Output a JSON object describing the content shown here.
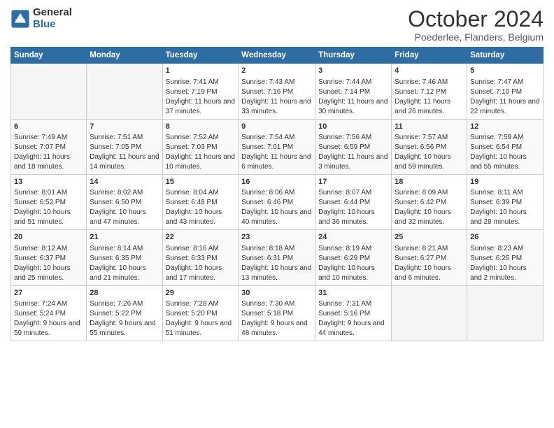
{
  "logo": {
    "general": "General",
    "blue": "Blue"
  },
  "title": "October 2024",
  "subtitle": "Poederlee, Flanders, Belgium",
  "days_of_week": [
    "Sunday",
    "Monday",
    "Tuesday",
    "Wednesday",
    "Thursday",
    "Friday",
    "Saturday"
  ],
  "weeks": [
    [
      {
        "day": "",
        "info": ""
      },
      {
        "day": "",
        "info": ""
      },
      {
        "day": "1",
        "info": "Sunrise: 7:41 AM\nSunset: 7:19 PM\nDaylight: 11 hours and 37 minutes."
      },
      {
        "day": "2",
        "info": "Sunrise: 7:43 AM\nSunset: 7:16 PM\nDaylight: 11 hours and 33 minutes."
      },
      {
        "day": "3",
        "info": "Sunrise: 7:44 AM\nSunset: 7:14 PM\nDaylight: 11 hours and 30 minutes."
      },
      {
        "day": "4",
        "info": "Sunrise: 7:46 AM\nSunset: 7:12 PM\nDaylight: 11 hours and 26 minutes."
      },
      {
        "day": "5",
        "info": "Sunrise: 7:47 AM\nSunset: 7:10 PM\nDaylight: 11 hours and 22 minutes."
      }
    ],
    [
      {
        "day": "6",
        "info": "Sunrise: 7:49 AM\nSunset: 7:07 PM\nDaylight: 11 hours and 18 minutes."
      },
      {
        "day": "7",
        "info": "Sunrise: 7:51 AM\nSunset: 7:05 PM\nDaylight: 11 hours and 14 minutes."
      },
      {
        "day": "8",
        "info": "Sunrise: 7:52 AM\nSunset: 7:03 PM\nDaylight: 11 hours and 10 minutes."
      },
      {
        "day": "9",
        "info": "Sunrise: 7:54 AM\nSunset: 7:01 PM\nDaylight: 11 hours and 6 minutes."
      },
      {
        "day": "10",
        "info": "Sunrise: 7:56 AM\nSunset: 6:59 PM\nDaylight: 11 hours and 3 minutes."
      },
      {
        "day": "11",
        "info": "Sunrise: 7:57 AM\nSunset: 6:56 PM\nDaylight: 10 hours and 59 minutes."
      },
      {
        "day": "12",
        "info": "Sunrise: 7:59 AM\nSunset: 6:54 PM\nDaylight: 10 hours and 55 minutes."
      }
    ],
    [
      {
        "day": "13",
        "info": "Sunrise: 8:01 AM\nSunset: 6:52 PM\nDaylight: 10 hours and 51 minutes."
      },
      {
        "day": "14",
        "info": "Sunrise: 8:02 AM\nSunset: 6:50 PM\nDaylight: 10 hours and 47 minutes."
      },
      {
        "day": "15",
        "info": "Sunrise: 8:04 AM\nSunset: 6:48 PM\nDaylight: 10 hours and 43 minutes."
      },
      {
        "day": "16",
        "info": "Sunrise: 8:06 AM\nSunset: 6:46 PM\nDaylight: 10 hours and 40 minutes."
      },
      {
        "day": "17",
        "info": "Sunrise: 8:07 AM\nSunset: 6:44 PM\nDaylight: 10 hours and 36 minutes."
      },
      {
        "day": "18",
        "info": "Sunrise: 8:09 AM\nSunset: 6:42 PM\nDaylight: 10 hours and 32 minutes."
      },
      {
        "day": "19",
        "info": "Sunrise: 8:11 AM\nSunset: 6:39 PM\nDaylight: 10 hours and 28 minutes."
      }
    ],
    [
      {
        "day": "20",
        "info": "Sunrise: 8:12 AM\nSunset: 6:37 PM\nDaylight: 10 hours and 25 minutes."
      },
      {
        "day": "21",
        "info": "Sunrise: 8:14 AM\nSunset: 6:35 PM\nDaylight: 10 hours and 21 minutes."
      },
      {
        "day": "22",
        "info": "Sunrise: 8:16 AM\nSunset: 6:33 PM\nDaylight: 10 hours and 17 minutes."
      },
      {
        "day": "23",
        "info": "Sunrise: 8:18 AM\nSunset: 6:31 PM\nDaylight: 10 hours and 13 minutes."
      },
      {
        "day": "24",
        "info": "Sunrise: 8:19 AM\nSunset: 6:29 PM\nDaylight: 10 hours and 10 minutes."
      },
      {
        "day": "25",
        "info": "Sunrise: 8:21 AM\nSunset: 6:27 PM\nDaylight: 10 hours and 6 minutes."
      },
      {
        "day": "26",
        "info": "Sunrise: 8:23 AM\nSunset: 6:25 PM\nDaylight: 10 hours and 2 minutes."
      }
    ],
    [
      {
        "day": "27",
        "info": "Sunrise: 7:24 AM\nSunset: 5:24 PM\nDaylight: 9 hours and 59 minutes."
      },
      {
        "day": "28",
        "info": "Sunrise: 7:26 AM\nSunset: 5:22 PM\nDaylight: 9 hours and 55 minutes."
      },
      {
        "day": "29",
        "info": "Sunrise: 7:28 AM\nSunset: 5:20 PM\nDaylight: 9 hours and 51 minutes."
      },
      {
        "day": "30",
        "info": "Sunrise: 7:30 AM\nSunset: 5:18 PM\nDaylight: 9 hours and 48 minutes."
      },
      {
        "day": "31",
        "info": "Sunrise: 7:31 AM\nSunset: 5:16 PM\nDaylight: 9 hours and 44 minutes."
      },
      {
        "day": "",
        "info": ""
      },
      {
        "day": "",
        "info": ""
      }
    ]
  ]
}
